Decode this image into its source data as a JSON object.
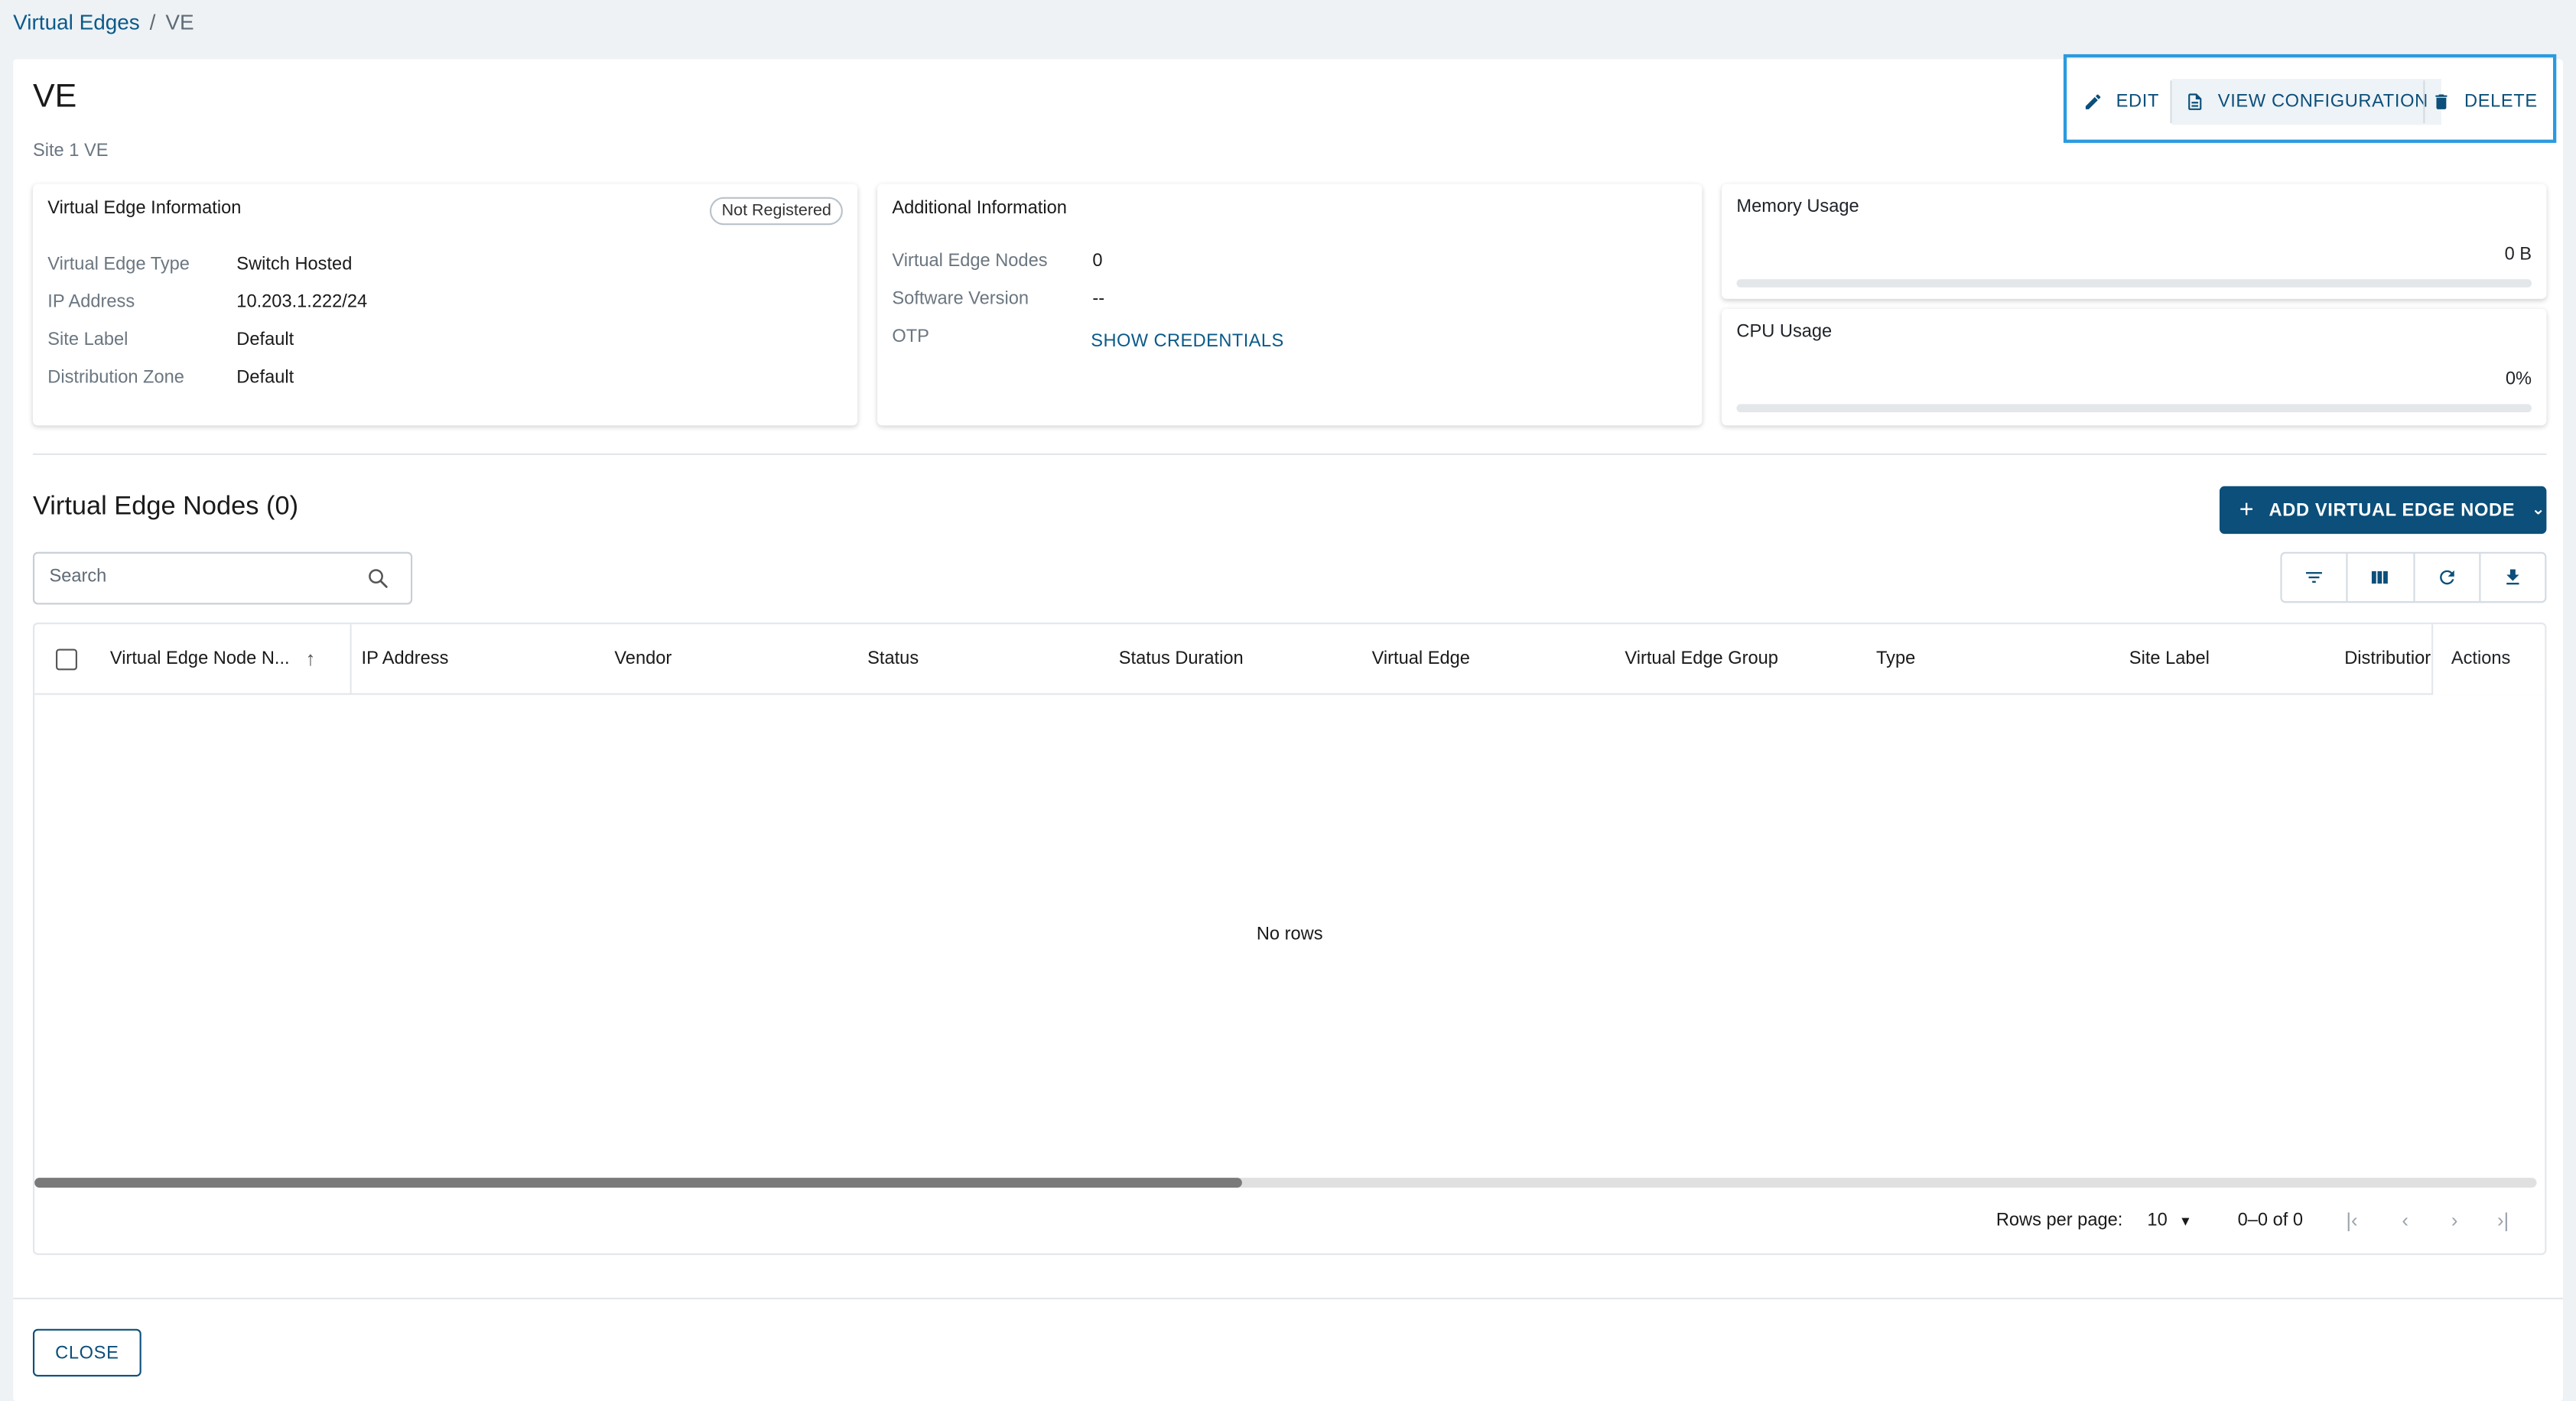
{
  "breadcrumb": {
    "parent": "Virtual Edges",
    "separator": "/",
    "current": "VE"
  },
  "header": {
    "title": "VE",
    "subtitle": "Site 1 VE"
  },
  "toolbar": {
    "edit_label": "EDIT",
    "view_config_label": "VIEW CONFIGURATION",
    "delete_label": "DELETE"
  },
  "ve_info": {
    "title": "Virtual Edge Information",
    "badge": "Not Registered",
    "rows": [
      {
        "label": "Virtual Edge Type",
        "value": "Switch Hosted"
      },
      {
        "label": "IP Address",
        "value": "10.203.1.222/24"
      },
      {
        "label": "Site Label",
        "value": "Default"
      },
      {
        "label": "Distribution Zone",
        "value": "Default"
      }
    ]
  },
  "additional_info": {
    "title": "Additional Information",
    "rows": [
      {
        "label": "Virtual Edge Nodes",
        "value": "0"
      },
      {
        "label": "Software Version",
        "value": "--"
      },
      {
        "label": "OTP",
        "value": "SHOW CREDENTIALS"
      }
    ]
  },
  "memory": {
    "title": "Memory Usage",
    "value": "0 B",
    "fraction": 0
  },
  "cpu": {
    "title": "CPU Usage",
    "value": "0%",
    "fraction": 0
  },
  "nodes": {
    "title": "Virtual Edge Nodes (0)",
    "add_label": "ADD VIRTUAL EDGE NODE",
    "search_placeholder": "Search",
    "columns": [
      "Virtual Edge Node N...",
      "IP Address",
      "Vendor",
      "Status",
      "Status Duration",
      "Virtual Edge",
      "Virtual Edge Group",
      "Type",
      "Site Label",
      "Distributior",
      "Actions"
    ],
    "empty_text": "No rows",
    "rows_per_page_label": "Rows per page:",
    "rows_per_page": "10",
    "range": "0–0 of 0"
  },
  "footer": {
    "close_label": "CLOSE"
  },
  "colors": {
    "accent": "#0b4f7a",
    "highlight": "#2a9ae0",
    "link": "#0b5a8a"
  },
  "icons": [
    "pencil-icon",
    "document-icon",
    "trash-icon",
    "plus-icon",
    "chevron-down-icon",
    "search-icon",
    "filter-icon",
    "columns-icon",
    "refresh-icon",
    "download-icon",
    "sort-up-icon",
    "first-page-icon",
    "prev-page-icon",
    "next-page-icon",
    "last-page-icon"
  ]
}
